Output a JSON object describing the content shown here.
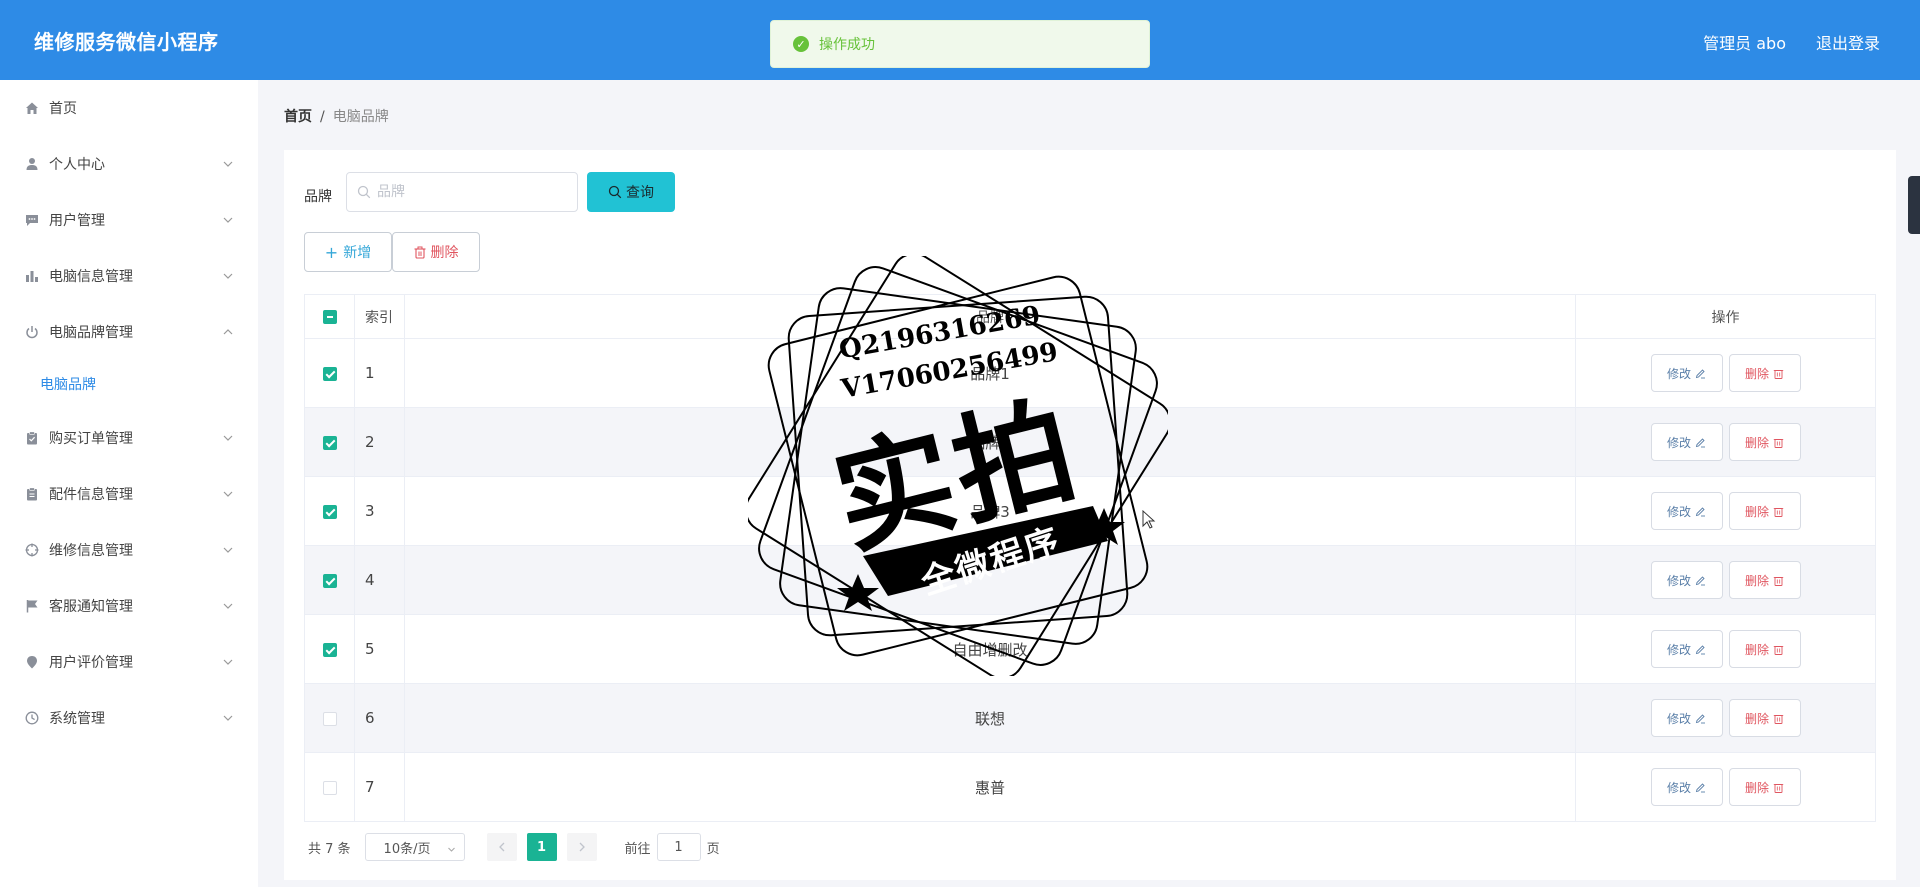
{
  "header": {
    "app_title": "维修服务微信小程序",
    "admin_label": "管理员 abo",
    "logout_label": "退出登录"
  },
  "toast": {
    "message": "操作成功"
  },
  "sidebar": {
    "items": [
      {
        "label": "首页",
        "icon": "home-icon"
      },
      {
        "label": "个人中心",
        "icon": "user-icon"
      },
      {
        "label": "用户管理",
        "icon": "chat-icon"
      },
      {
        "label": "电脑信息管理",
        "icon": "bar-chart-icon"
      },
      {
        "label": "电脑品牌管理",
        "icon": "power-icon",
        "expanded": true
      },
      {
        "label": "电脑品牌",
        "sub": true,
        "active": true
      },
      {
        "label": "购买订单管理",
        "icon": "clipboard-icon"
      },
      {
        "label": "配件信息管理",
        "icon": "clipboard-icon"
      },
      {
        "label": "维修信息管理",
        "icon": "crosshair-icon"
      },
      {
        "label": "客服通知管理",
        "icon": "flag-icon"
      },
      {
        "label": "用户评价管理",
        "icon": "pin-icon"
      },
      {
        "label": "系统管理",
        "icon": "clock-icon"
      }
    ]
  },
  "breadcrumb": {
    "home": "首页",
    "separator": "/",
    "current": "电脑品牌"
  },
  "search": {
    "label": "品牌",
    "placeholder": "品牌",
    "value": "",
    "query_label": "查询"
  },
  "actions": {
    "add_label": "新增",
    "delete_label": "删除"
  },
  "table": {
    "headers": {
      "index": "索引",
      "brand": "品牌",
      "operation": "操作"
    },
    "rows": [
      {
        "index": "1",
        "brand": "品牌1",
        "checked": true
      },
      {
        "index": "2",
        "brand": "品牌2",
        "checked": true
      },
      {
        "index": "3",
        "brand": "品牌3",
        "checked": true
      },
      {
        "index": "4",
        "brand": "",
        "checked": true
      },
      {
        "index": "5",
        "brand": "自由增删改",
        "checked": true
      },
      {
        "index": "6",
        "brand": "联想",
        "checked": false
      },
      {
        "index": "7",
        "brand": "惠普",
        "checked": false
      }
    ],
    "edit_label": "修改",
    "remove_label": "删除"
  },
  "pagination": {
    "total": "共 7 条",
    "page_size": "10条/页",
    "current_page": "1",
    "goto_label": "前往",
    "goto_value": "1",
    "page_unit": "页"
  },
  "watermark": {
    "line1": "Q2196316269",
    "line2": "V17060256499",
    "big": "实拍",
    "banner": "全微程序"
  },
  "colors": {
    "header_bg": "#2e8be6",
    "accent_green": "#1ab394",
    "query_button": "#21c2d4",
    "danger": "#e0555f",
    "success_toast": "#f0f9eb"
  }
}
